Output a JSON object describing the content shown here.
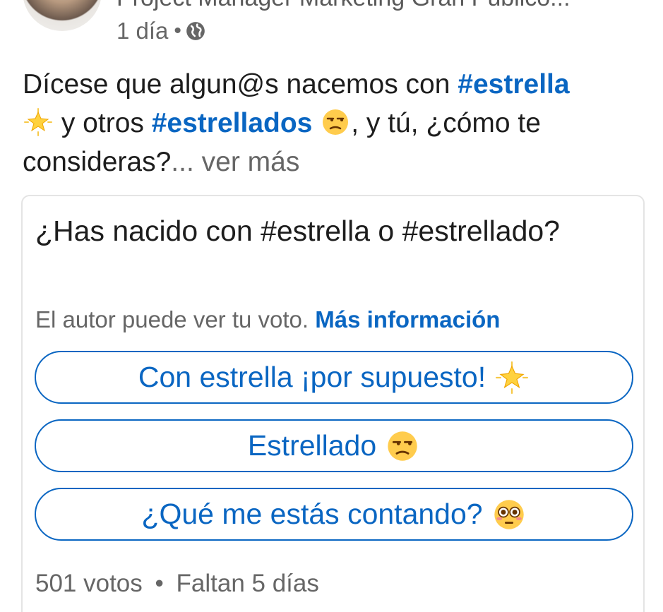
{
  "header": {
    "author_subtitle": "Project Manager Marketing Gran Público...",
    "time": "1 día",
    "separator": "•",
    "visibility_icon": "globe-icon"
  },
  "post": {
    "text_1": "Dícese que algun@s nacemos con ",
    "hashtag_1": "#estrella",
    "emoji_1": "glowing-star-emoji",
    "text_2": " y otros ",
    "hashtag_2": "#estrellados",
    "emoji_2": "unamused-face-emoji",
    "text_3": ", y tú, ¿cómo te consideras?",
    "ellipsis": "...",
    "see_more": "ver más"
  },
  "poll": {
    "question": "¿Has nacido con #estrella o #estrellado?",
    "note": "El autor puede ver tu voto.",
    "more_info": "Más información",
    "options": [
      {
        "label": "Con estrella ¡por supuesto!",
        "emoji": "glowing-star-emoji"
      },
      {
        "label": "Estrellado",
        "emoji": "unamused-face-emoji"
      },
      {
        "label": "¿Qué me estás contando?",
        "emoji": "flushed-face-emoji"
      }
    ],
    "votes": "501 votos",
    "separator": "•",
    "remaining": "Faltan 5 días"
  },
  "colors": {
    "accent": "#0a66c2",
    "text": "#1d1d1d",
    "muted": "#666666",
    "border": "#e4e4e4"
  }
}
